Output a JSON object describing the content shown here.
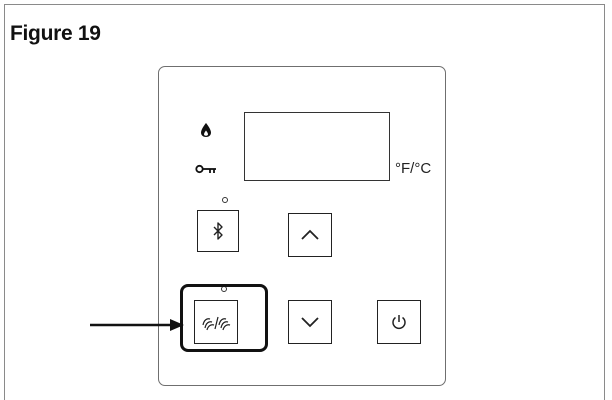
{
  "figure": {
    "title": "Figure 19"
  },
  "panel": {
    "unit_label": "°F/°C",
    "icons": {
      "flame": "flame-icon",
      "key": "key-icon",
      "bluetooth": "bluetooth-icon",
      "up": "chevron-up-icon",
      "down": "chevron-down-icon",
      "recirculation": "recirculation-icon",
      "power": "power-icon"
    }
  },
  "callout": {
    "highlighted_button": "recirculation",
    "icon": "arrow-right-icon"
  }
}
